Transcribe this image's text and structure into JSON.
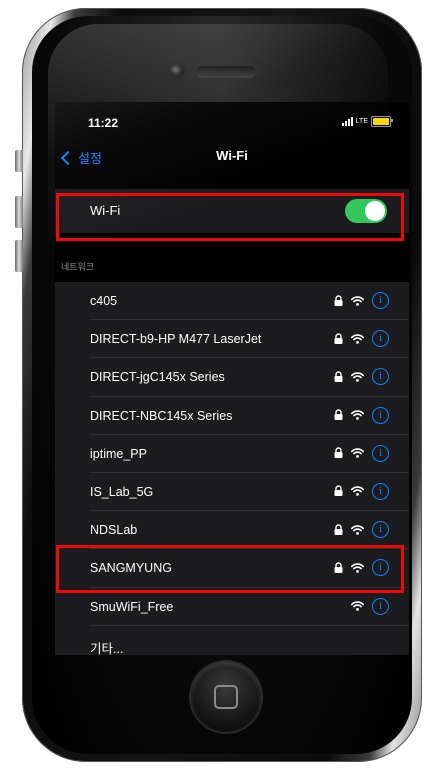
{
  "status_bar": {
    "time": "11:22",
    "network": "LTE"
  },
  "nav": {
    "back_label": "설정",
    "title": "Wi-Fi"
  },
  "wifi_toggle": {
    "label": "Wi-Fi",
    "on": true
  },
  "networks_header": "네트워크",
  "networks": [
    {
      "name": "c405",
      "locked": true
    },
    {
      "name": "DIRECT-b9-HP M477 LaserJet",
      "locked": true
    },
    {
      "name": "DIRECT-jgC145x Series",
      "locked": true
    },
    {
      "name": "DIRECT-NBC145x Series",
      "locked": true
    },
    {
      "name": "iptime_PP",
      "locked": true
    },
    {
      "name": "IS_Lab_5G",
      "locked": true
    },
    {
      "name": "NDSLab",
      "locked": true
    },
    {
      "name": "SANGMYUNG",
      "locked": true
    },
    {
      "name": "SmuWiFi_Free",
      "locked": false
    },
    {
      "name": "기타...",
      "other": true
    }
  ],
  "info_glyph": "i",
  "colors": {
    "accent": "#0a84ff",
    "toggle_on": "#34c759",
    "highlight": "#ee0a0a",
    "battery": "#ffd60a"
  }
}
